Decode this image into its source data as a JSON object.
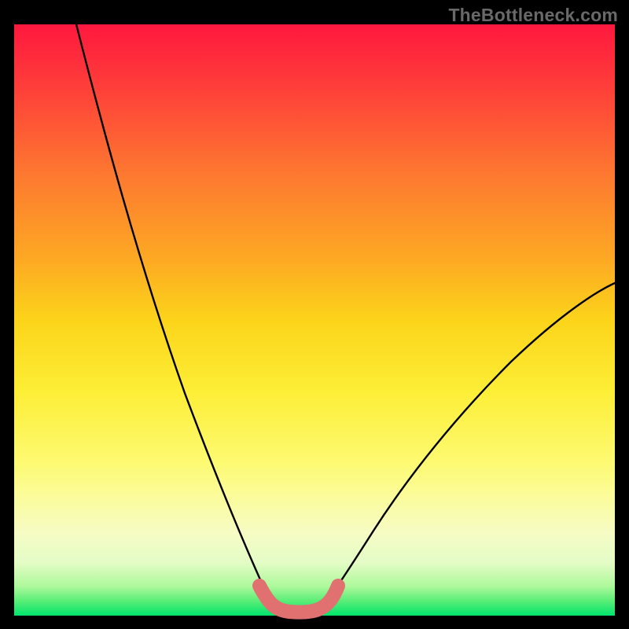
{
  "watermark": {
    "text": "TheBottleneck.com"
  },
  "chart_data": {
    "type": "line",
    "title": "",
    "xlabel": "",
    "ylabel": "",
    "xlim": [
      0,
      100
    ],
    "ylim": [
      0,
      100
    ],
    "grid": false,
    "legend": false,
    "background_gradient": {
      "stops": [
        {
          "offset": 0.0,
          "color": "#fe183e"
        },
        {
          "offset": 0.5,
          "color": "#fcd41a"
        },
        {
          "offset": 0.78,
          "color": "#fbfb8b"
        },
        {
          "offset": 0.85,
          "color": "#f7fcbe"
        },
        {
          "offset": 0.97,
          "color": "#87f780"
        },
        {
          "offset": 1.0,
          "color": "#00e46d"
        }
      ]
    },
    "series": [
      {
        "name": "left-branch",
        "type": "curve",
        "x": [
          10.3,
          14,
          19,
          24,
          29,
          34,
          38,
          41.5,
          43.3
        ],
        "values": [
          100,
          84,
          67,
          50,
          34,
          20,
          10,
          4,
          1.5
        ]
      },
      {
        "name": "right-branch",
        "type": "curve",
        "x": [
          51.3,
          55,
          60,
          67,
          75,
          84,
          92,
          100
        ],
        "values": [
          1.5,
          5,
          11,
          20,
          30,
          40,
          48,
          55
        ]
      },
      {
        "name": "pink-band",
        "type": "path",
        "stroke": "#e17070",
        "stroke_width": 18,
        "x": [
          40.8,
          43.3,
          45.7,
          49,
          51.3,
          53.8
        ],
        "values": [
          5,
          1.5,
          0.5,
          0.5,
          1.5,
          5
        ]
      }
    ],
    "notes": "Axes are unlabeled in the source image; x and y are on a 0–100 normalized scale. y=0 is the green bottom edge, y=100 is the red top edge. The two black curves descend from opposite sides into a flat trough around x≈43–51, where they meet a thick pink highlight band drawn on top."
  }
}
